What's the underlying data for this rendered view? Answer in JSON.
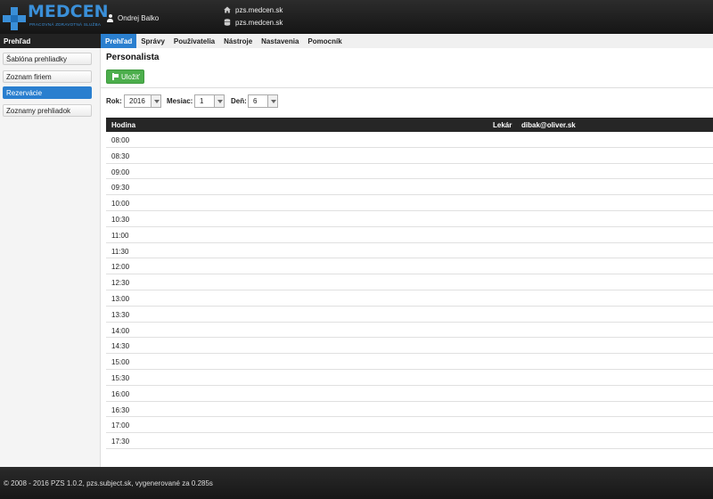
{
  "header": {
    "logo_text": "MEDCEN",
    "logo_sub": "PRACOVNÁ ZDRAVOTNÁ SLUŽBA",
    "user_name": "Ondrej Balko",
    "site_home": "pzs.medcen.sk",
    "site_db": "pzs.medcen.sk"
  },
  "sidebar": {
    "title": "Prehľad",
    "items": [
      {
        "label": "Šablóna prehliadky"
      },
      {
        "label": "Zoznam firiem"
      },
      {
        "label": "Rezervácie"
      },
      {
        "label": "Zoznamy prehliadok"
      }
    ]
  },
  "tabs": [
    {
      "label": "Prehľad"
    },
    {
      "label": "Správy"
    },
    {
      "label": "Používatelia"
    },
    {
      "label": "Nástroje"
    },
    {
      "label": "Nastavenia"
    },
    {
      "label": "Pomocník"
    }
  ],
  "main": {
    "title": "Personalista",
    "save_label": "Uložiť",
    "filters": {
      "year_label": "Rok:",
      "year_value": "2016",
      "month_label": "Mesiac:",
      "month_value": "1",
      "day_label": "Deň:",
      "day_value": "6"
    },
    "table": {
      "col_hour": "Hodina",
      "col_doctor": "Lekár",
      "col_email": "dibak@oliver.sk",
      "hours": [
        "08:00",
        "08:30",
        "09:00",
        "09:30",
        "10:00",
        "10:30",
        "11:00",
        "11:30",
        "12:00",
        "12:30",
        "13:00",
        "13:30",
        "14:00",
        "14:30",
        "15:00",
        "15:30",
        "16:00",
        "16:30",
        "17:00",
        "17:30"
      ]
    }
  },
  "footer": {
    "text": "© 2008 - 2016 PZS 1.0.2, pzs.subject.sk, vygenerované za 0.285s"
  },
  "colors": {
    "accent": "#2a7fcf",
    "save_green": "#4cae4c",
    "header_dark": "#1e1e1e"
  },
  "icons": [
    "user-icon",
    "home-icon",
    "database-icon",
    "flag-icon",
    "chevron-down-icon"
  ]
}
